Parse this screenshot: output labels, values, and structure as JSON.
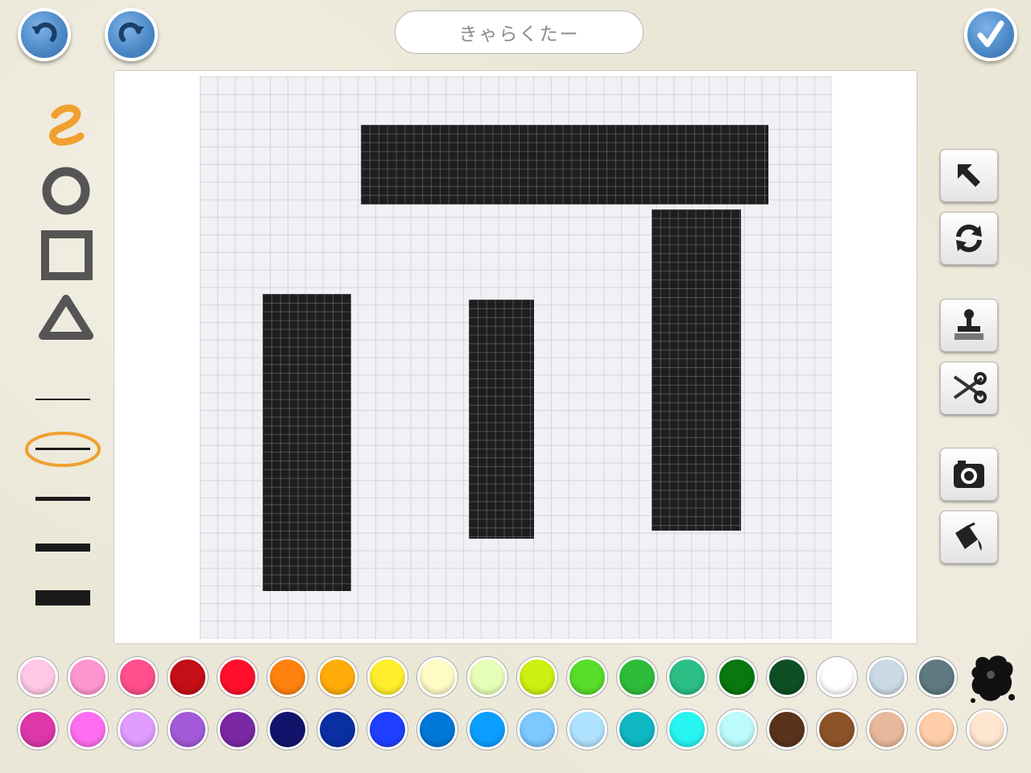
{
  "header": {
    "title": "きゃらくたー",
    "undo_icon": "undo-arrow-icon",
    "redo_icon": "redo-arrow-icon",
    "done_icon": "checkmark-icon"
  },
  "tools": {
    "shapes": [
      "freehand-squiggle-icon",
      "circle-brush-icon",
      "square-brush-icon",
      "triangle-brush-icon"
    ],
    "selected_shape": "freehand-squiggle-icon",
    "line_widths_count": 5,
    "selected_line_width_index": 2
  },
  "side_tools": [
    "select-arrow-icon",
    "rotate-icon",
    "stamp-icon",
    "scissors-icon",
    "camera-icon",
    "paint-bucket-icon"
  ],
  "palette": {
    "row1": [
      "#ffc8e6",
      "#ff96d0",
      "#ff4f8c",
      "#c40f16",
      "#ff0f2b",
      "#ff8210",
      "#ffac0a",
      "#ffee2c",
      "#fffbc4",
      "#e6ffb8",
      "#cdf010",
      "#58dd2a",
      "#2ebd3a",
      "#2bbf86",
      "#08780f",
      "#0e4f24",
      "#ffffff",
      "#cad9e6",
      "#5f7980"
    ],
    "row2": [
      "#dd37aa",
      "#ff6ef0",
      "#e09cff",
      "#a45ad8",
      "#7b28a4",
      "#12146c",
      "#0a2fa2",
      "#1e3fff",
      "#0077d8",
      "#0a9fff",
      "#7cc8ff",
      "#afe2ff",
      "#10b8c4",
      "#28f5f2",
      "#bcfbfb",
      "#5a331d",
      "#8c5428",
      "#e8b89c",
      "#ffcda8",
      "#ffe6d0"
    ],
    "ink_icon": "black-ink-splat-icon"
  },
  "accent": "#f0a030"
}
